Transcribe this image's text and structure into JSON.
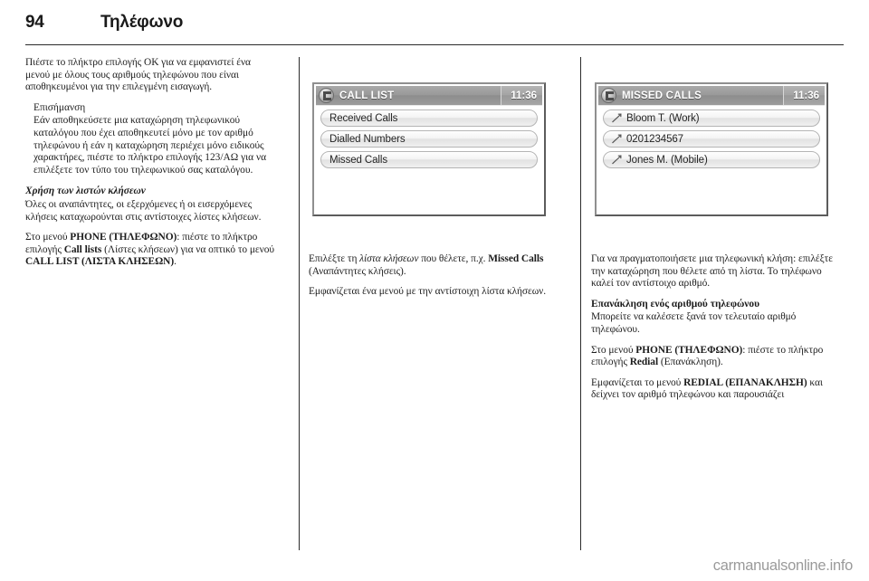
{
  "header": {
    "page_number": "94",
    "section_title": "Τηλέφωνο"
  },
  "column1": {
    "intro": "Πιέστε το πλήκτρο επιλογής OK για να εμφανιστεί ένα μενού με όλους τους αριθμούς τηλεφώνου που είναι αποθηκευμένοι για την επιλεγμένη εισαγωγή.",
    "note_title": "Επισήμανση",
    "note_body": "Εάν αποθηκεύσετε μια καταχώρηση τηλεφωνικού καταλόγου που έχει αποθηκευτεί μόνο με τον αριθμό τηλεφώνου ή εάν η καταχώρηση περιέχει μόνο ειδικούς χαρακτήρες, πιέστε το πλήκτρο επιλογής 123/AΩ για να επιλέξετε τον τύπο του τηλεφωνικού σας καταλόγου.",
    "subheading": "Χρήση των λιστών κλήσεων",
    "para2": "Όλες οι αναπάντητες, οι εξερχόμενες ή οι εισερχόμενες κλήσεις καταχωρούνται στις αντίστοιχες λίστες κλήσεων.",
    "para3_pre": "Στο μενού ",
    "para3_b1": "PHONE (ΤΗΛΕΦΩΝΟ)",
    "para3_mid1": ": πιέστε το πλήκτρο επιλογής ",
    "para3_b2": "Call lists",
    "para3_mid2": " (Λίστες κλήσεων) για να οπτικό το μενού ",
    "para3_b3": "CALL LIST (ΛΙΣΤΑ ΚΛΗΣΕΩΝ)",
    "para3_end": "."
  },
  "screen1": {
    "icon": "phone-globe-icon",
    "title": "CALL LIST",
    "clock": "11:36",
    "items": [
      {
        "label": "Received Calls",
        "icon": null
      },
      {
        "label": "Dialled Numbers",
        "icon": null
      },
      {
        "label": "Missed Calls",
        "icon": null
      }
    ]
  },
  "column2": {
    "para1_pre": "Επιλέξτε τη ",
    "para1_i1": "λίστα κλήσεων",
    "para1_mid": " που θέλετε, π.χ. ",
    "para1_b1": "Missed Calls",
    "para1_end": " (Αναπάντητες κλήσεις).",
    "para2": "Εμφανίζεται ένα μενού με την αντίστοιχη λίστα κλήσεων."
  },
  "screen2": {
    "icon": "phone-globe-icon",
    "title": "MISSED CALLS",
    "clock": "11:36",
    "items": [
      {
        "label": "Bloom T. (Work)",
        "icon": "missed-call-arrow-icon"
      },
      {
        "label": "0201234567",
        "icon": "missed-call-arrow-icon"
      },
      {
        "label": "Jones M. (Mobile)",
        "icon": "missed-call-arrow-icon"
      }
    ]
  },
  "column3": {
    "para1": "Για να πραγματοποιήσετε μια τηλεφωνική κλήση: επιλέξτε την καταχώρηση που θέλετε από τη λίστα. Το τηλέφωνο καλεί τον αντίστοιχο αριθμό.",
    "subheading": "Επανάκληση ενός αριθμού τηλεφώνου",
    "para2": "Μπορείτε να καλέσετε ξανά τον τελευταίο αριθμό τηλεφώνου.",
    "para3_pre": "Στο μενού ",
    "para3_b1": "PHONE (ΤΗΛΕΦΩΝΟ)",
    "para3_mid": ": πιέστε το πλήκτρο επιλογής ",
    "para3_b2": "Redial",
    "para3_end": " (Επανάκληση).",
    "para4_pre": "Εμφανίζεται το μενού ",
    "para4_b1": "REDIAL (ΕΠΑΝΑΚΛΗΣΗ)",
    "para4_end": " και δείχνει τον αριθμό τηλεφώνου και παρουσιάζει"
  },
  "footer": {
    "watermark": "carmanualsonline.info"
  }
}
